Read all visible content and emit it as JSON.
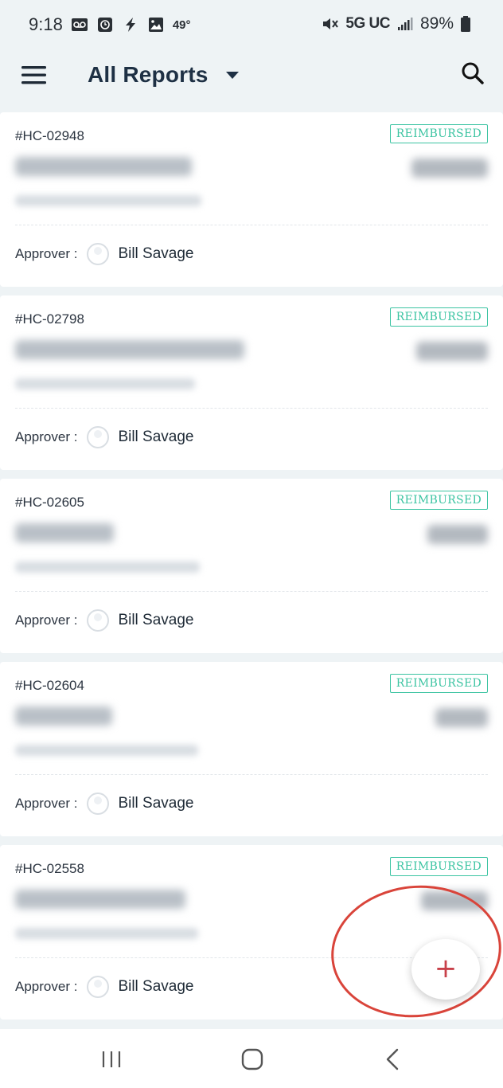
{
  "status_bar": {
    "time": "9:18",
    "temperature": "49°",
    "network": "5G UC",
    "battery": "89%",
    "icons": [
      "voicemail-icon",
      "clock-app-icon",
      "lightning-icon",
      "gallery-icon",
      "mute-icon",
      "signal-icon",
      "battery-icon"
    ]
  },
  "header": {
    "title": "All Reports",
    "icons": [
      "menu-icon",
      "dropdown-caret-icon",
      "search-icon"
    ]
  },
  "reports": [
    {
      "id": "#HC-02948",
      "status": "REIMBURSED",
      "approver_label": "Approver :",
      "approver": "Bill Savage"
    },
    {
      "id": "#HC-02798",
      "status": "REIMBURSED",
      "approver_label": "Approver :",
      "approver": "Bill Savage"
    },
    {
      "id": "#HC-02605",
      "status": "REIMBURSED",
      "approver_label": "Approver :",
      "approver": "Bill Savage"
    },
    {
      "id": "#HC-02604",
      "status": "REIMBURSED",
      "approver_label": "Approver :",
      "approver": "Bill Savage"
    },
    {
      "id": "#HC-02558",
      "status": "REIMBURSED",
      "approver_label": "Approver :",
      "approver": "Bill Savage"
    }
  ],
  "fab": {
    "label": "+"
  },
  "colors": {
    "background": "#eef3f5",
    "status_green": "#3cc4a2",
    "title": "#1e3044",
    "fab_plus": "#c8404a",
    "highlight": "#d9443a"
  }
}
